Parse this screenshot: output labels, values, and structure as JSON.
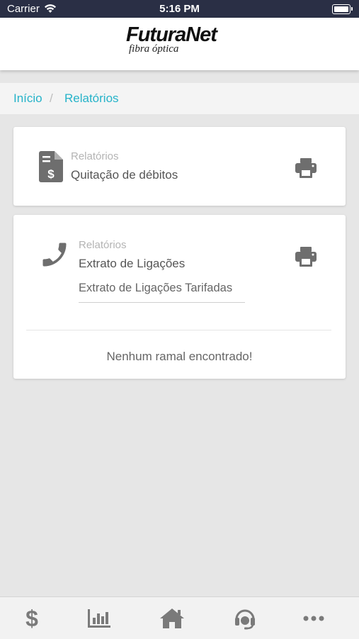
{
  "status_bar": {
    "carrier": "Carrier",
    "time": "5:16 PM"
  },
  "header": {
    "brand": "FuturaNet",
    "tagline": "fibra óptica"
  },
  "breadcrumb": {
    "items": [
      "Início",
      "Relatórios"
    ],
    "separator": "/"
  },
  "cards": [
    {
      "category": "Relatórios",
      "title": "Quitação de débitos",
      "icon": "invoice-dollar-icon",
      "action_icon": "print-icon"
    },
    {
      "category": "Relatórios",
      "title": "Extrato de Ligações",
      "icon": "phone-icon",
      "action_icon": "print-icon",
      "select_value": "Extrato de Ligações Tarifadas",
      "empty_message": "Nenhum ramal encontrado!"
    }
  ],
  "tab_bar": {
    "items": [
      {
        "icon": "dollar-icon"
      },
      {
        "icon": "bar-chart-icon"
      },
      {
        "icon": "home-icon"
      },
      {
        "icon": "support-headset-icon"
      },
      {
        "icon": "more-icon"
      }
    ]
  },
  "colors": {
    "accent": "#26b3c9",
    "status_bar": "#2a2f45",
    "icon_gray": "#6e6e6e",
    "background": "#e6e6e6"
  }
}
